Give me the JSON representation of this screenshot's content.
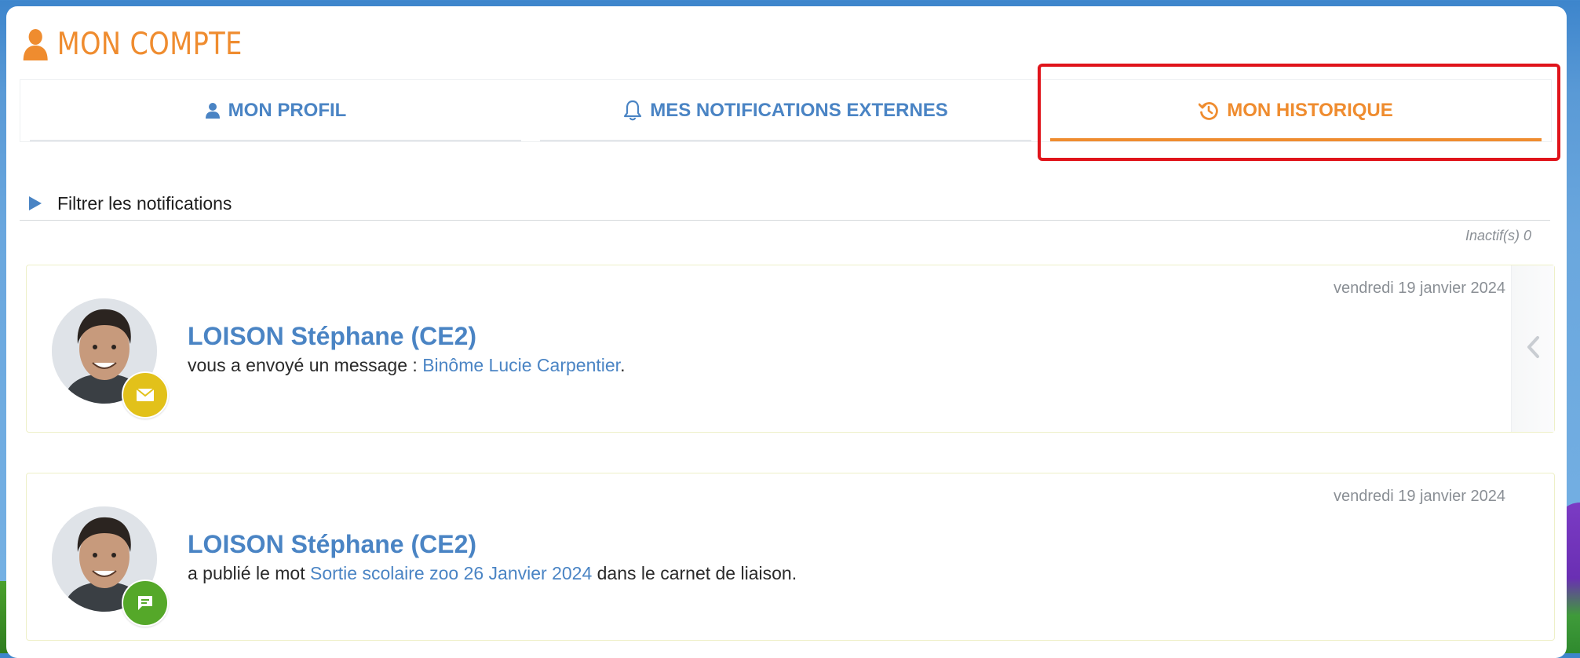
{
  "page": {
    "title": "MON COMPTE",
    "title_icon": "user-icon",
    "accent_color": "#ef8c2f",
    "link_color": "#4a84c4"
  },
  "tabs": [
    {
      "label": "MON PROFIL",
      "icon": "user-icon",
      "active": false
    },
    {
      "label": "MES NOTIFICATIONS EXTERNES",
      "icon": "bell-icon",
      "active": false
    },
    {
      "label": "MON HISTORIQUE",
      "icon": "history-icon",
      "active": true
    }
  ],
  "filter": {
    "label": "Filtrer les notifications"
  },
  "inactive_count": "Inactif(s) 0",
  "notifications": [
    {
      "date": "vendredi 19 janvier 2024",
      "author": "LOISON Stéphane (CE2)",
      "text_before": "vous a envoyé un message : ",
      "link": "Binôme Lucie Carpentier",
      "text_after": ".",
      "badge": "envelope-icon",
      "badge_color": "#e2c11a"
    },
    {
      "date": "vendredi 19 janvier 2024",
      "author": "LOISON Stéphane (CE2)",
      "text_before": "a publié le mot ",
      "link": "Sortie scolaire zoo 26 Janvier 2024",
      "text_after": " dans le carnet de liaison.",
      "badge": "chat-bubble-icon",
      "badge_color": "#55a829"
    }
  ]
}
